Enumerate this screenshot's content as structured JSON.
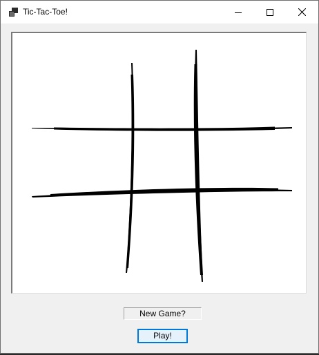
{
  "window": {
    "title": "Tic-Tac-Toe!",
    "icon": "app-window-icon",
    "controls": {
      "minimize_icon": "minimize-icon",
      "maximize_icon": "maximize-icon",
      "close_icon": "close-icon"
    }
  },
  "board": {
    "grid_style": "hand-drawn",
    "line_color": "#000000",
    "background": "#ffffff"
  },
  "status": {
    "label": "New Game?"
  },
  "actions": {
    "play_label": "Play!",
    "play_accent": "#0078d7"
  }
}
